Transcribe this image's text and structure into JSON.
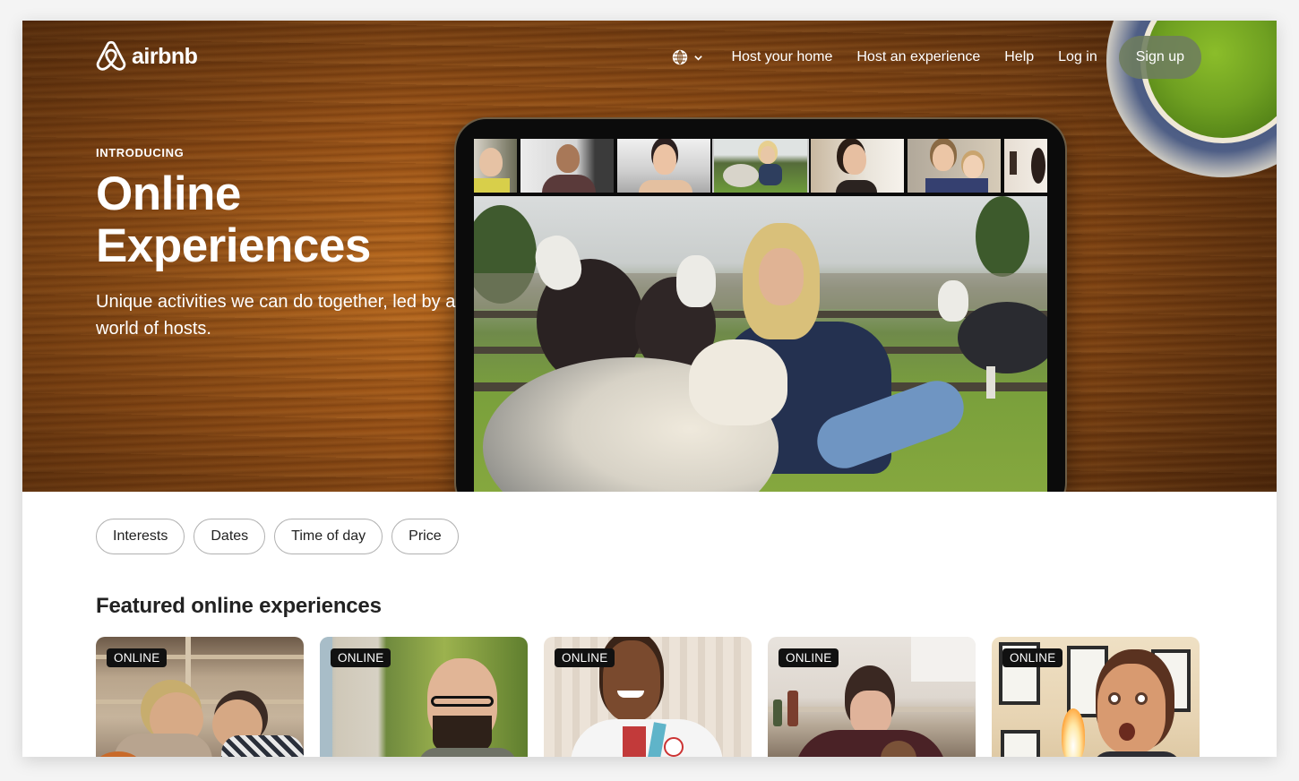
{
  "nav": {
    "brand": "airbnb",
    "language_icon": "globe-icon",
    "links": [
      "Host your home",
      "Host an experience",
      "Help",
      "Log in"
    ],
    "signup_label": "Sign up"
  },
  "hero": {
    "eyebrow": "INTRODUCING",
    "title_line1": "Online",
    "title_line2": "Experiences",
    "subtitle": "Unique activities we can do together, led by a world of hosts."
  },
  "filters": [
    "Interests",
    "Dates",
    "Time of day",
    "Price"
  ],
  "featured": {
    "title": "Featured online experiences",
    "cards": [
      {
        "badge": "ONLINE"
      },
      {
        "badge": "ONLINE"
      },
      {
        "badge": "ONLINE"
      },
      {
        "badge": "ONLINE"
      },
      {
        "badge": "ONLINE"
      }
    ]
  }
}
